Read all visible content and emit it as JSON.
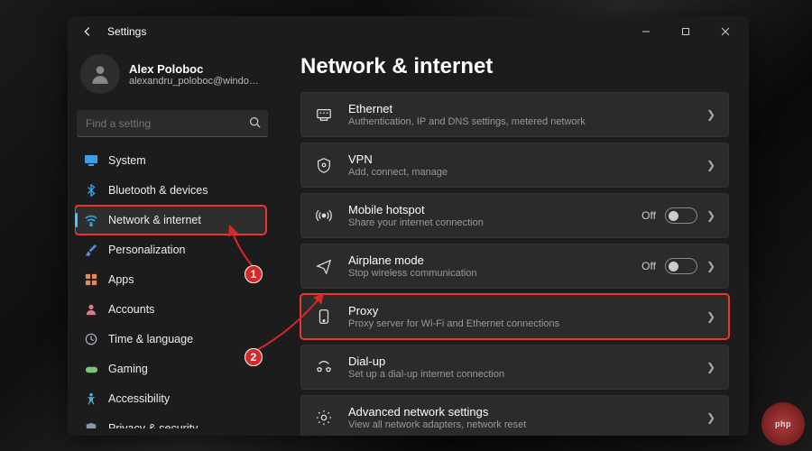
{
  "app_title": "Settings",
  "user": {
    "name": "Alex Poloboc",
    "email": "alexandru_poloboc@windowsreport..."
  },
  "search": {
    "placeholder": "Find a setting"
  },
  "sidebar": {
    "items": [
      {
        "label": "System",
        "icon": "display-icon",
        "color": "#3a9fe6"
      },
      {
        "label": "Bluetooth & devices",
        "icon": "bluetooth-icon",
        "color": "#3a9fe6"
      },
      {
        "label": "Network & internet",
        "icon": "wifi-icon",
        "color": "#3a9fe6",
        "active": true,
        "highlight": true
      },
      {
        "label": "Personalization",
        "icon": "brush-icon",
        "color": "#5a8ad6"
      },
      {
        "label": "Apps",
        "icon": "apps-icon",
        "color": "#e68a5c"
      },
      {
        "label": "Accounts",
        "icon": "person-icon",
        "color": "#d67f8a"
      },
      {
        "label": "Time & language",
        "icon": "clock-icon",
        "color": "#aab2c0"
      },
      {
        "label": "Gaming",
        "icon": "gamepad-icon",
        "color": "#7cc47c"
      },
      {
        "label": "Accessibility",
        "icon": "accessibility-icon",
        "color": "#5ab0c4"
      },
      {
        "label": "Privacy & security",
        "icon": "shield-icon",
        "color": "#8a96a8"
      }
    ]
  },
  "page": {
    "title": "Network & internet"
  },
  "cards": [
    {
      "icon": "ethernet-icon",
      "title": "Ethernet",
      "desc": "Authentication, IP and DNS settings, metered network",
      "chevron": true
    },
    {
      "icon": "vpn-icon",
      "title": "VPN",
      "desc": "Add, connect, manage",
      "chevron": true
    },
    {
      "icon": "hotspot-icon",
      "title": "Mobile hotspot",
      "desc": "Share your internet connection",
      "toggle": "Off",
      "chevron": true
    },
    {
      "icon": "airplane-icon",
      "title": "Airplane mode",
      "desc": "Stop wireless communication",
      "toggle": "Off",
      "chevron": true
    },
    {
      "icon": "proxy-icon",
      "title": "Proxy",
      "desc": "Proxy server for Wi-Fi and Ethernet connections",
      "chevron": true,
      "highlight": true
    },
    {
      "icon": "dialup-icon",
      "title": "Dial-up",
      "desc": "Set up a dial-up internet connection",
      "chevron": true
    },
    {
      "icon": "advanced-icon",
      "title": "Advanced network settings",
      "desc": "View all network adapters, network reset",
      "chevron": true
    }
  ],
  "annotations": {
    "marker1": "1",
    "marker2": "2"
  },
  "watermark": "php"
}
